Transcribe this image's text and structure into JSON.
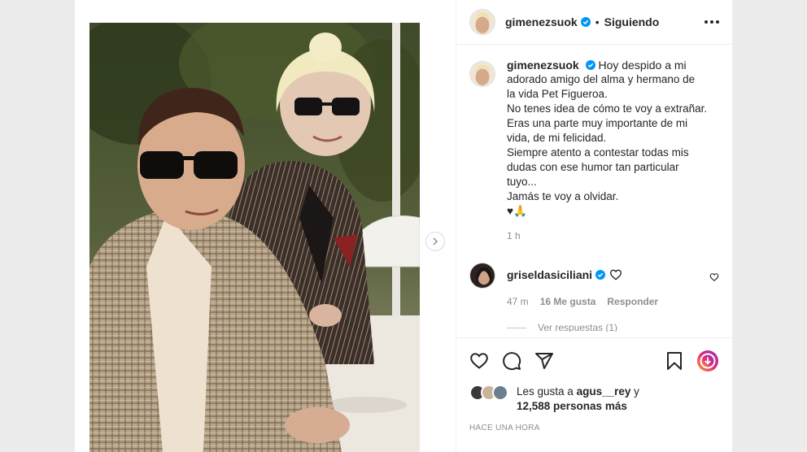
{
  "post": {
    "author": {
      "username": "gimenezsuok",
      "verified": true,
      "follow_status": "Siguiendo"
    },
    "caption": {
      "username": "gimenezsuok",
      "first_line": "Hoy despido a mi",
      "lines": [
        "adorado amigo del alma y hermano de",
        "la vida Pet Figueroa.",
        "No tenes idea de cómo te voy a extrañar.",
        "Eras una parte muy importante de mi",
        "vida, de mi felicidad.",
        "Siempre atento a contestar todas mis",
        "dudas con ese humor tan particular",
        "tuyo...",
        "Jamás te voy a olvidar.",
        "♥🙏"
      ],
      "time": "1 h"
    },
    "comment": {
      "username": "griseldasiciliani",
      "time": "47 m",
      "likes": "16 Me gusta",
      "reply": "Responder",
      "view_replies": "Ver respuestas (1)"
    },
    "likes": {
      "prefix": "Les gusta a",
      "user": "agus__rey",
      "connector": "y",
      "count_text": "12,588 personas más"
    },
    "timestamp": "HACE UNA HORA"
  },
  "icons": {
    "like": "heart-icon",
    "comment": "comment-icon",
    "share": "send-icon",
    "save": "bookmark-icon",
    "more": "more-icon",
    "next": "chevron-right-icon"
  },
  "colors": {
    "verified": "#0095f6",
    "text": "#262626",
    "secondary": "#8e8e8e",
    "divider": "#efefef"
  }
}
